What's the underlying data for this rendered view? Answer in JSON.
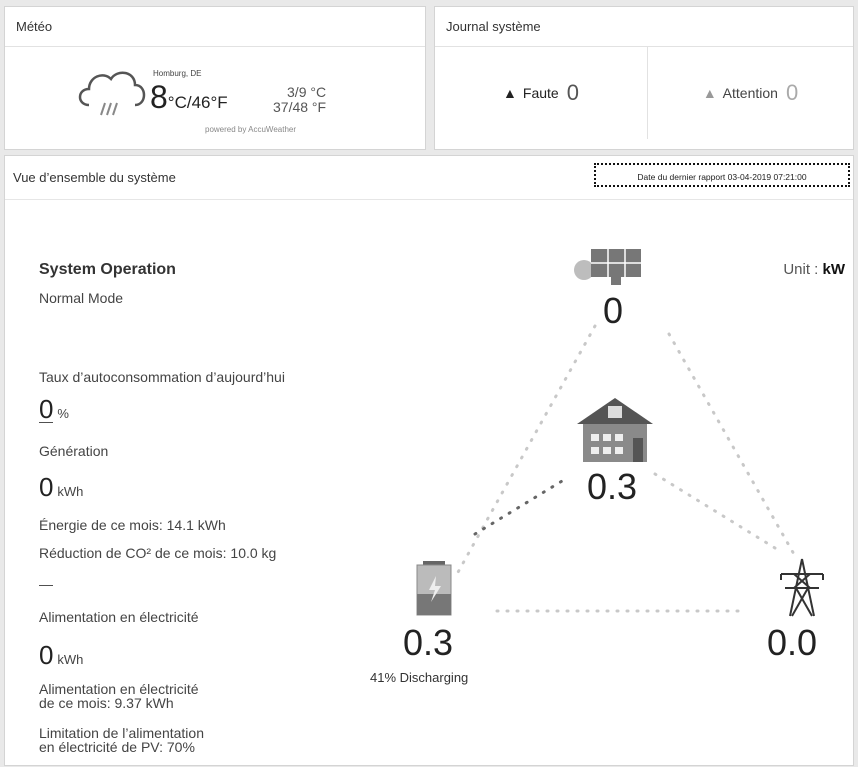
{
  "weather": {
    "title": "Météo",
    "city": "Homburg, DE",
    "temp_big": "8",
    "temp_unit": "°C/46°F",
    "range_c": "3/9 °C",
    "range_f": "37/48 °F",
    "powered": "powered by AccuWeather"
  },
  "journal": {
    "title": "Journal système",
    "fault_label": "Faute",
    "fault_count": "0",
    "warning_label": "Attention",
    "warning_count": "0"
  },
  "overview": {
    "title": "Vue d’ensemble du système",
    "report": "Date du dernier rapport 03-04-2019 07:21:00",
    "unit_label": "Unit :",
    "unit_value": "kW",
    "system_operation": "System Operation",
    "mode": "Normal Mode",
    "self_consumption_label": "Taux d’autoconsommation d’aujourd’hui",
    "self_consumption_value": "0",
    "self_consumption_unit": "%",
    "dash": "—",
    "generation_label": "Génération",
    "generation_value": "0",
    "generation_unit": "kWh",
    "energy_month": "Énergie de ce mois: 14.1 kWh",
    "co2_month": "Réduction de CO² de ce mois: 10.0 kg",
    "feed_label": "Alimentation en électricité",
    "feed_value": "0",
    "feed_unit": "kWh",
    "feed_month_1": "Alimentation en électricité",
    "feed_month_2": "de ce mois: 9.37 kWh",
    "limit_1": "Limitation de l’alimentation",
    "limit_2": "en électricité de PV: 70%"
  },
  "diagram": {
    "pv_value": "0",
    "home_value": "0.3",
    "battery_value": "0.3",
    "battery_status": "41% Discharging",
    "grid_value": "0.0",
    "battery_level_fraction": 0.41
  }
}
